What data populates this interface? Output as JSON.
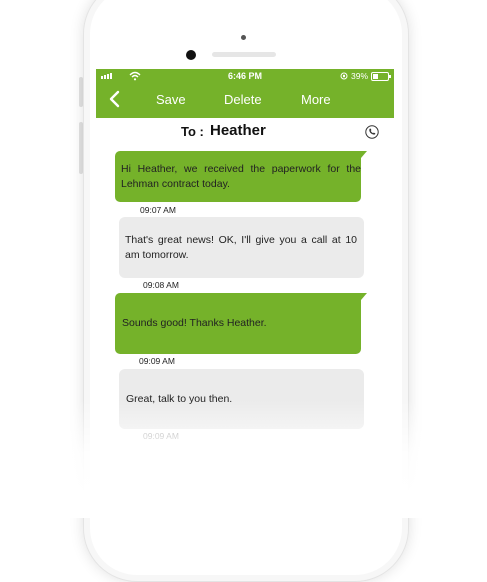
{
  "status_bar": {
    "time": "6:46 PM",
    "battery": "39%"
  },
  "nav": {
    "back_icon": "chevron-left-icon",
    "save_label": "Save",
    "delete_label": "Delete",
    "more_label": "More"
  },
  "recipient": {
    "to_label": "To :",
    "name": "Heather",
    "call_icon": "phone-icon"
  },
  "messages": [
    {
      "direction": "sent",
      "text": "Hi Heather, we received the paperwork for the Lehman contract today.",
      "time": "09:07 AM"
    },
    {
      "direction": "received",
      "text": "That's great news! OK, I'll give you a call at 10 am tomorrow.",
      "time": "09:08 AM"
    },
    {
      "direction": "sent",
      "text": "Sounds good! Thanks Heather.",
      "time": "09:09 AM"
    },
    {
      "direction": "received",
      "text": "Great, talk to you then.",
      "time": "09:09 AM"
    }
  ],
  "colors": {
    "accent": "#75b22a",
    "received_bubble": "#ebebeb"
  }
}
